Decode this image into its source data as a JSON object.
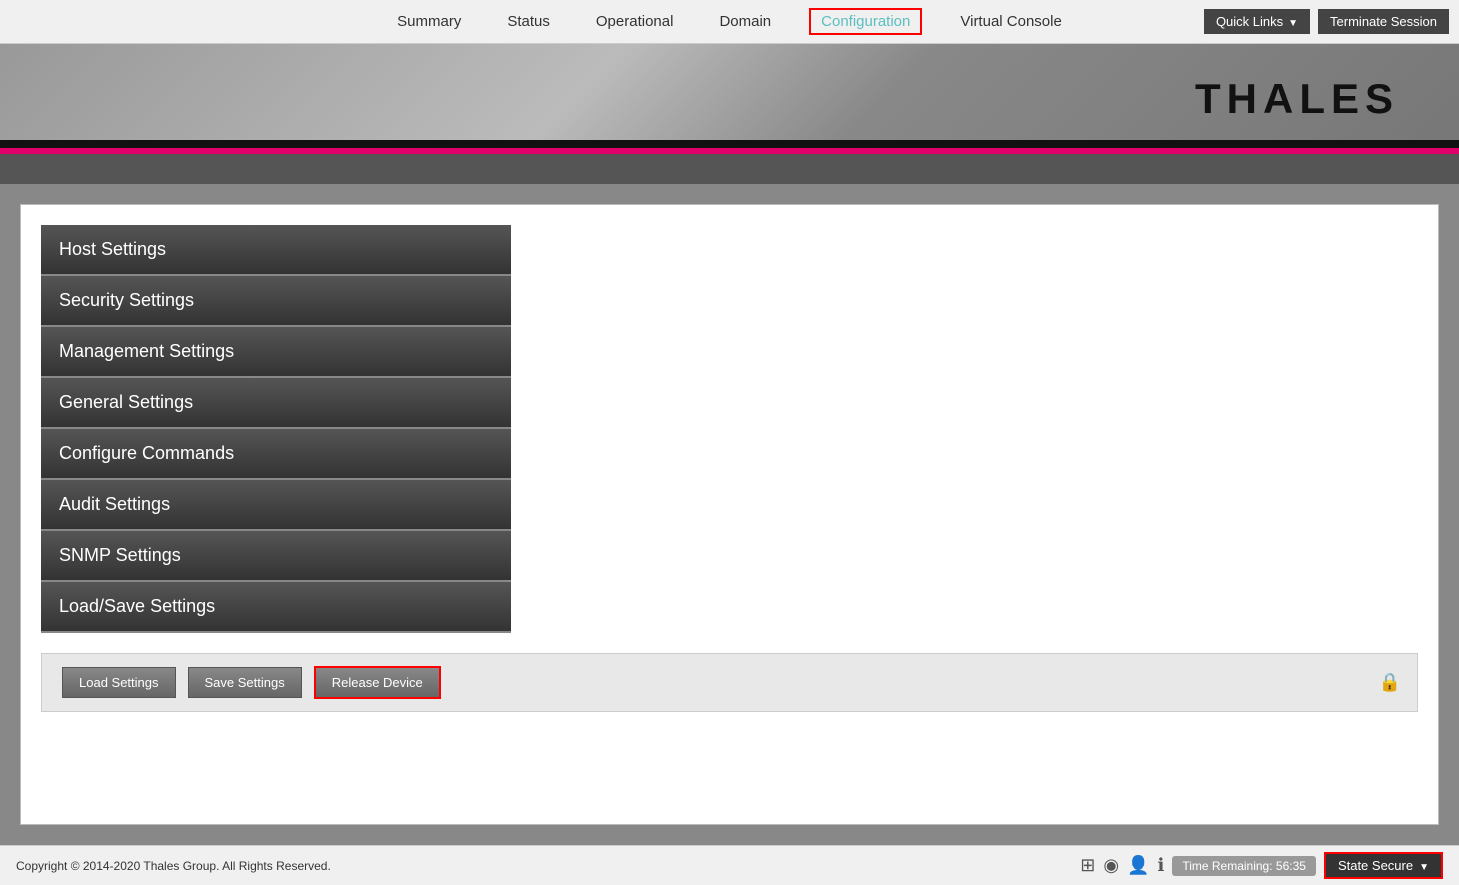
{
  "nav": {
    "links": [
      {
        "label": "Summary",
        "id": "summary",
        "active": false
      },
      {
        "label": "Status",
        "id": "status",
        "active": false
      },
      {
        "label": "Operational",
        "id": "operational",
        "active": false
      },
      {
        "label": "Domain",
        "id": "domain",
        "active": false
      },
      {
        "label": "Configuration",
        "id": "configuration",
        "active": true
      },
      {
        "label": "Virtual Console",
        "id": "virtual-console",
        "active": false
      }
    ],
    "quick_links_label": "Quick Links",
    "terminate_session_label": "Terminate Session"
  },
  "header": {
    "logo_text": "THALES"
  },
  "sidebar": {
    "items": [
      {
        "label": "Host Settings"
      },
      {
        "label": "Security Settings"
      },
      {
        "label": "Management Settings"
      },
      {
        "label": "General Settings"
      },
      {
        "label": "Configure Commands"
      },
      {
        "label": "Audit Settings"
      },
      {
        "label": "SNMP Settings"
      },
      {
        "label": "Load/Save Settings"
      }
    ]
  },
  "action_bar": {
    "load_settings_label": "Load Settings",
    "save_settings_label": "Save Settings",
    "release_device_label": "Release Device"
  },
  "footer": {
    "copyright": "Copyright © 2014-2020 Thales Group. All Rights Reserved.",
    "time_remaining": "Time Remaining: 56:35",
    "state_secure_label": "State Secure"
  }
}
